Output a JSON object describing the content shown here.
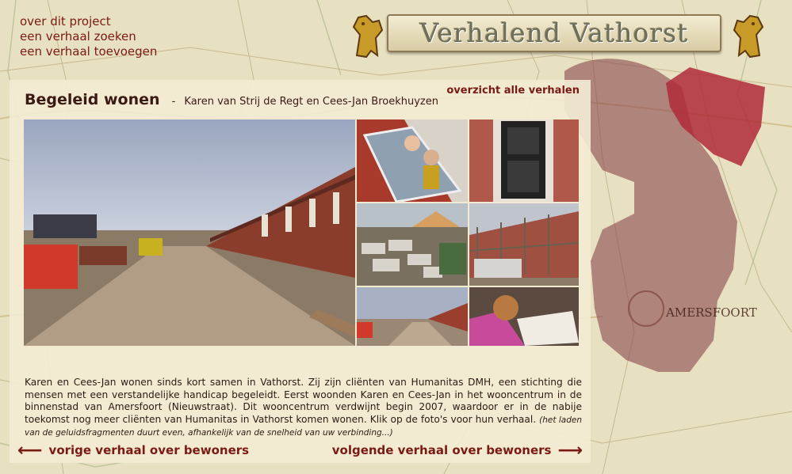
{
  "nav": {
    "about": "over dit project",
    "search": "een verhaal zoeken",
    "add": "een verhaal toevoegen"
  },
  "banner": {
    "title": "Verhalend Vathorst"
  },
  "story": {
    "title": "Begeleid wonen",
    "separator": "-",
    "authors": "Karen van Strij de Regt en Cees-Jan Broekhuyzen",
    "overview_link": "overzicht alle verhalen",
    "body": "Karen en Cees-Jan wonen sinds kort samen in Vathorst. Zij zijn cliënten van Humanitas DMH, een stichting die mensen met een verstandelijke handicap begeleidt. Eerst woonden Karen en Cees-Jan in het wooncentrum in de binnenstad van Amersfoort (Nieuwstraat). Dit wooncentrum verdwijnt begin 2007, waardoor er in de nabije toekomst nog meer cliënten van Humanitas in Vathorst komen wonen. Klik op de foto's voor hun verhaal.",
    "note": "(het laden van de geluidsfragmenten duurt even, afhankelijk van de snelheid van uw verbinding...)"
  },
  "footer": {
    "prev": "vorige verhaal over bewoners",
    "next": "volgende verhaal over bewoners"
  },
  "map_label": "AMERSFOORT",
  "colors": {
    "accent": "#7a1a14",
    "district_highlight": "#b02a3a",
    "district_area": "#8c4a4f"
  }
}
